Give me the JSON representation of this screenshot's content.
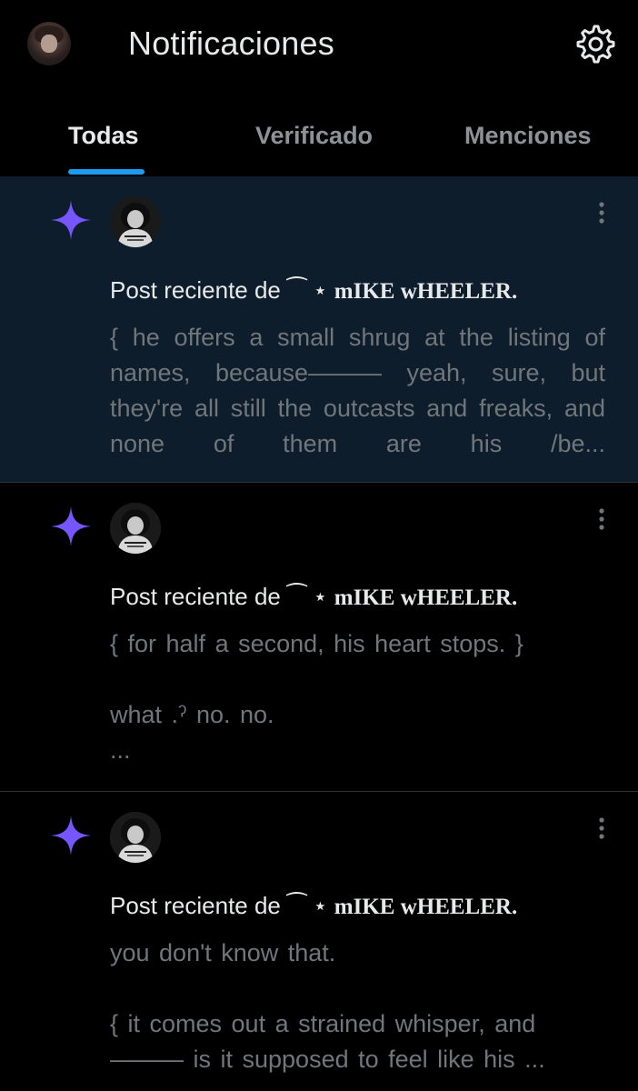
{
  "header": {
    "title": "Notificaciones",
    "avatar_icon": "profile-avatar",
    "settings_icon": "gear-icon"
  },
  "tabs": [
    {
      "label": "Todas",
      "active": true
    },
    {
      "label": "Verificado",
      "active": false
    },
    {
      "label": "Menciones",
      "active": false
    }
  ],
  "colors": {
    "background": "#000000",
    "unread_background": "#0d1d2c",
    "accent": "#1d9bf0",
    "sparkle": "#7856ff",
    "muted_text": "#71767b"
  },
  "notifications": [
    {
      "icon": "sparkle-icon",
      "unread": true,
      "prefix": "Post reciente de",
      "decoration": "⁀ ⋆",
      "author": "mIKE wHEELER.",
      "text": "{ he offers a small shrug at the listing of names, because——— yeah, sure, but they're all still the outcasts and freaks, and none of them are his /be..."
    },
    {
      "icon": "sparkle-icon",
      "unread": false,
      "prefix": "Post reciente de",
      "decoration": "⁀ ⋆",
      "author": "mIKE wHEELER.",
      "text": "{ for half a second, his heart stops. }\n\nwhat .ˀ no. no.\n..."
    },
    {
      "icon": "sparkle-icon",
      "unread": false,
      "prefix": "Post reciente de",
      "decoration": "⁀ ⋆",
      "author": "mIKE wHEELER.",
      "text": "you don't know that.\n\n{ it comes out a strained whisper, and ——— is it supposed to feel like his ..."
    }
  ]
}
